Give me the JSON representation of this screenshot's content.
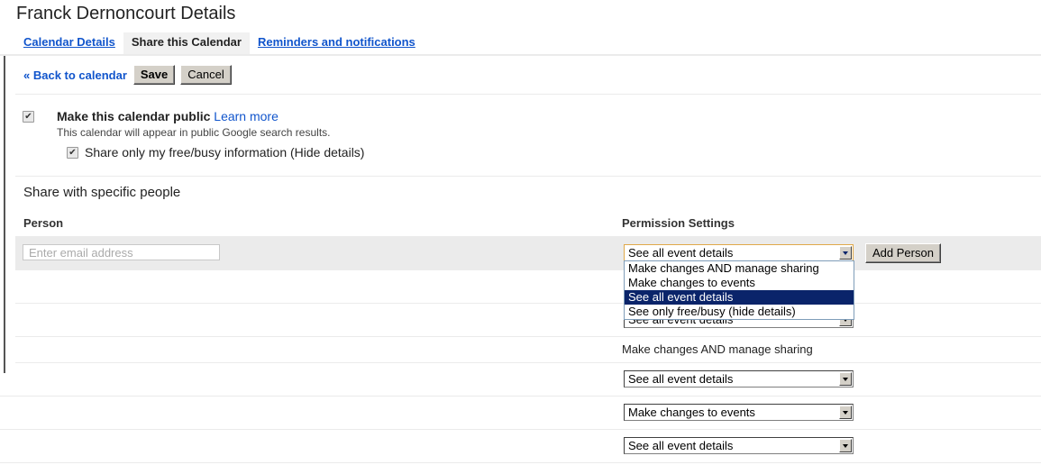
{
  "page": {
    "title": "Franck Dernoncourt Details"
  },
  "tabs": [
    {
      "label": "Calendar Details",
      "active": false
    },
    {
      "label": "Share this Calendar",
      "active": true
    },
    {
      "label": "Reminders and notifications",
      "active": false
    }
  ],
  "toolbar": {
    "back_label": "« Back to calendar",
    "save_label": "Save",
    "cancel_label": "Cancel"
  },
  "public": {
    "checkbox_label": "Make this calendar public",
    "checked": true,
    "learn_more": "Learn more",
    "description": "This calendar will appear in public Google search results.",
    "freebusy_label": "Share only my free/busy information (Hide details)",
    "freebusy_checked": true
  },
  "share": {
    "section_title": "Share with specific people",
    "col_person": "Person",
    "col_permission": "Permission Settings",
    "email_placeholder": "Enter email address",
    "new_permission_value": "See all event details",
    "add_person_label": "Add Person",
    "dropdown_options": [
      "Make changes AND manage sharing",
      "Make changes to events",
      "See all event details",
      "See only free/busy (hide details)"
    ],
    "dropdown_selected_index": 2,
    "rows": [
      {
        "person": "",
        "permission": "See all event details",
        "type": "select"
      },
      {
        "person": "",
        "permission": "Make changes AND manage sharing",
        "type": "text"
      },
      {
        "person": "",
        "permission": "See all event details",
        "type": "select"
      },
      {
        "person": "",
        "permission": "Make changes to events",
        "type": "select"
      },
      {
        "person": "",
        "permission": "See all event details",
        "type": "select"
      }
    ]
  }
}
